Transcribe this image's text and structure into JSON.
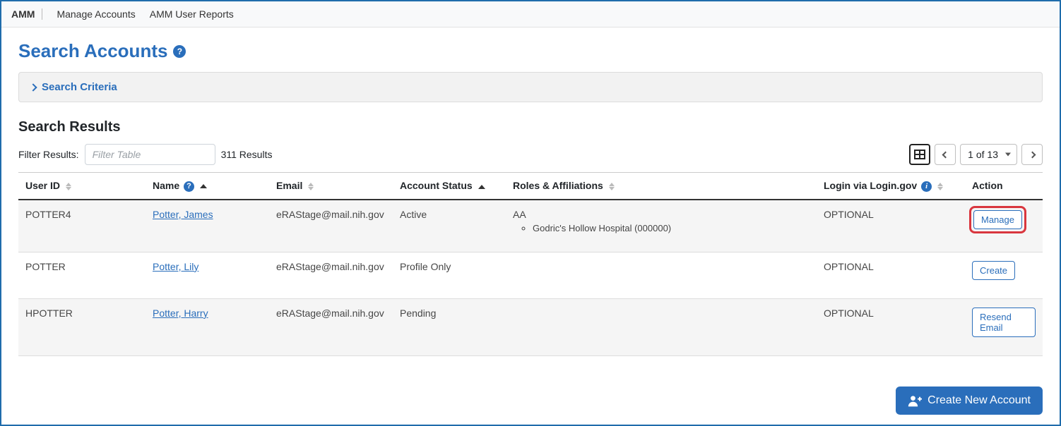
{
  "topbar": {
    "brand": "AMM",
    "nav": [
      "Manage Accounts",
      "AMM User Reports"
    ]
  },
  "page": {
    "title": "Search Accounts",
    "criteria_label": "Search Criteria",
    "results_title": "Search Results"
  },
  "filter": {
    "label": "Filter Results:",
    "placeholder": "Filter Table",
    "count_text": "311 Results"
  },
  "pager": {
    "page_label": "1 of 13"
  },
  "columns": {
    "user_id": "User ID",
    "name": "Name",
    "email": "Email",
    "account_status": "Account Status",
    "roles": "Roles & Affiliations",
    "login": "Login via Login.gov",
    "action": "Action"
  },
  "rows": [
    {
      "user_id": "POTTER4",
      "name": "Potter, James",
      "email": "eRAStage@mail.nih.gov",
      "status": "Active",
      "role_code": "AA",
      "affiliations": [
        "Godric's Hollow Hospital (000000)"
      ],
      "login": "OPTIONAL",
      "action": "Manage",
      "highlight": true
    },
    {
      "user_id": "POTTER",
      "name": "Potter, Lily",
      "email": "eRAStage@mail.nih.gov",
      "status": "Profile Only",
      "role_code": "",
      "affiliations": [],
      "login": "OPTIONAL",
      "action": "Create",
      "highlight": false
    },
    {
      "user_id": "HPOTTER",
      "name": "Potter, Harry",
      "email": "eRAStage@mail.nih.gov",
      "status": "Pending",
      "role_code": "",
      "affiliations": [],
      "login": "OPTIONAL",
      "action": "Resend Email",
      "highlight": false
    }
  ],
  "footer": {
    "create_label": "Create New Account"
  }
}
